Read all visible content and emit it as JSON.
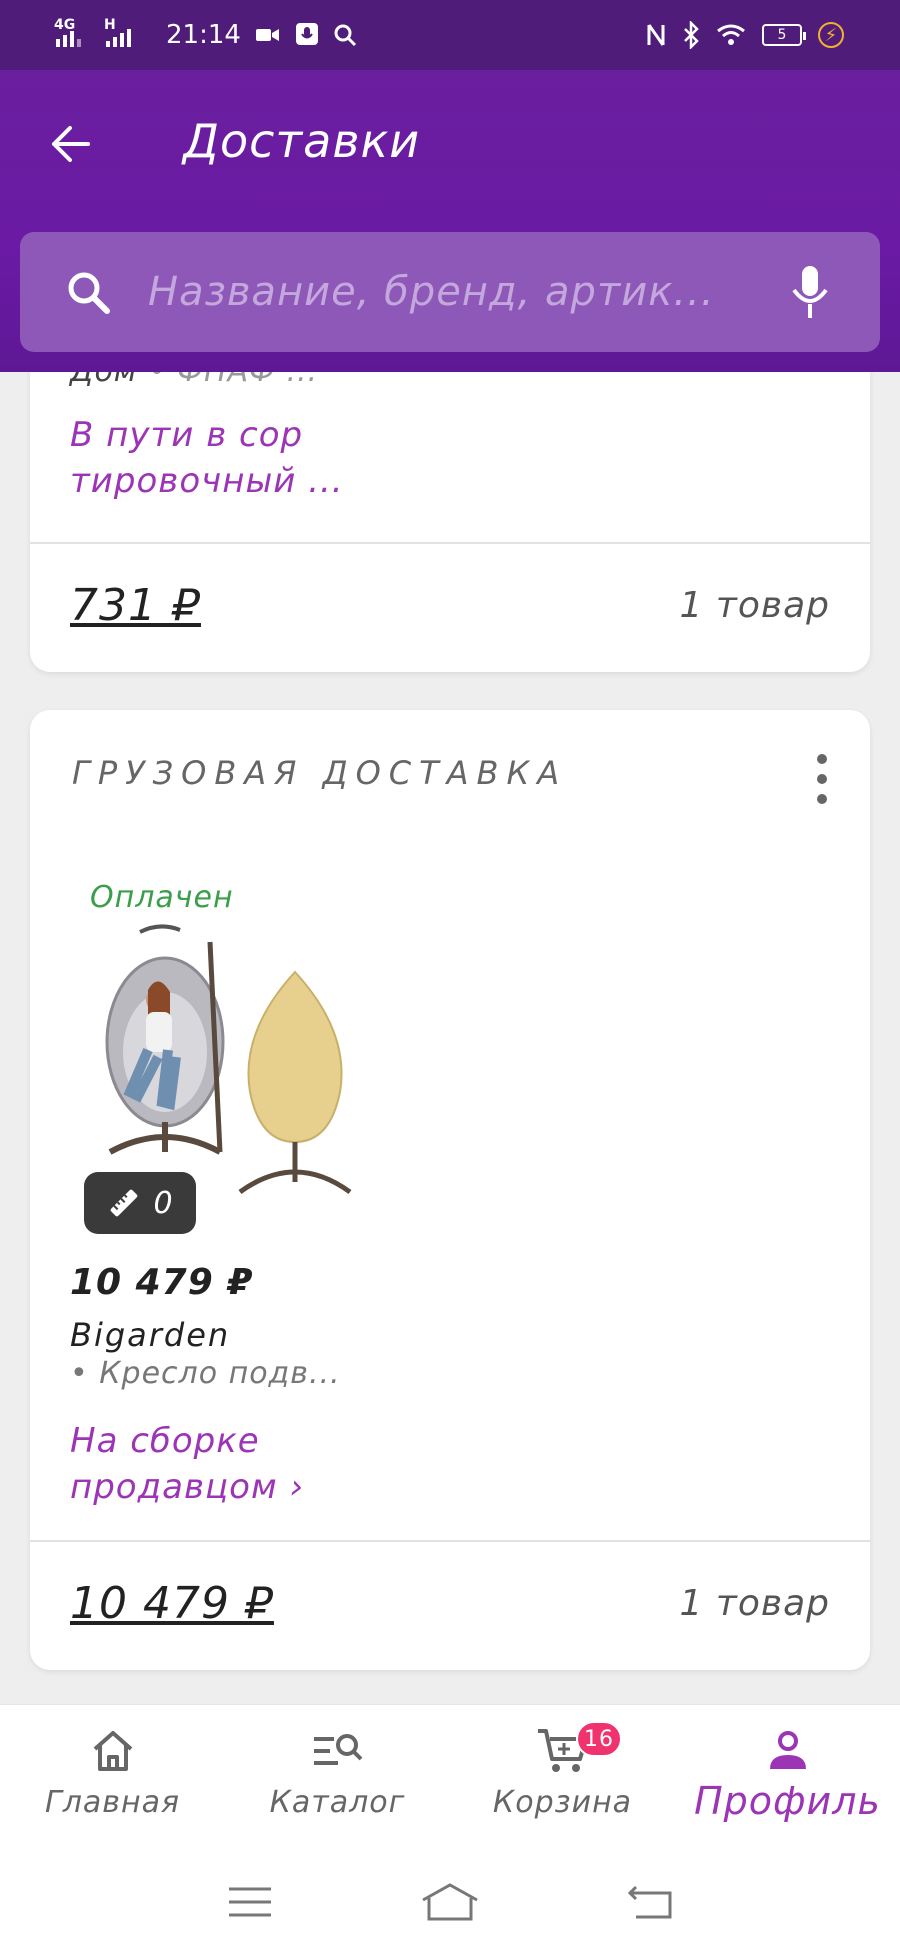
{
  "status_bar": {
    "network_1": "4G",
    "network_2": "H",
    "time": "21:14",
    "battery": "5"
  },
  "header": {
    "title": "Доставки"
  },
  "search": {
    "placeholder": "Название, бренд, артик..."
  },
  "delivery_1": {
    "category_text": "Дом",
    "seller_text": "• ФНАФ ...",
    "status_line_1": "В пути в сор",
    "status_line_2": "тировочный ...",
    "total": "731 ₽",
    "count": "1 товар"
  },
  "delivery_2": {
    "section_title": "ГРУЗОВАЯ ДОСТАВКА",
    "payment_badge": "Оплачен",
    "size_count": "0",
    "price": "10 479 ₽",
    "brand": "Bigarden",
    "name": "• Кресло подв...",
    "status_line_1": "На сборке",
    "status_line_2": "продавцом ›",
    "total": "10 479 ₽",
    "count": "1 товар"
  },
  "bottom_nav": {
    "home": "Главная",
    "catalog": "Каталог",
    "cart": "Корзина",
    "cart_badge": "16",
    "profile": "Профиль",
    "active": "profile"
  },
  "colors": {
    "primary": "#6a1fa0",
    "accent": "#9c35b5",
    "paid_green": "#3b9e4a",
    "badge_pink": "#f0326e"
  }
}
